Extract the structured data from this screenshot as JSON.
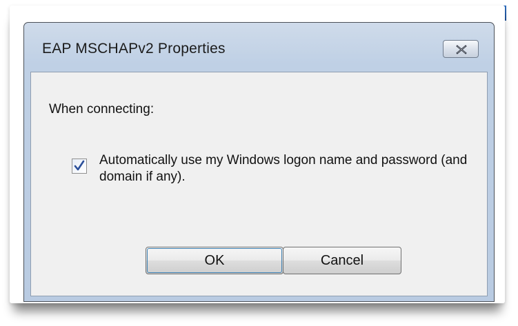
{
  "dialog": {
    "title": "EAP MSCHAPv2 Properties",
    "close_icon": "close-icon"
  },
  "content": {
    "heading": "When connecting:",
    "auto_logon_checkbox": {
      "checked": true,
      "label": "Automatically use my Windows logon name and password (and domain if any)."
    }
  },
  "buttons": {
    "ok_label": "OK",
    "cancel_label": "Cancel"
  },
  "colors": {
    "titlebar": "#bfd0e5",
    "client_bg": "#f0f0f0",
    "default_button_focus": "#3c7fb1"
  }
}
